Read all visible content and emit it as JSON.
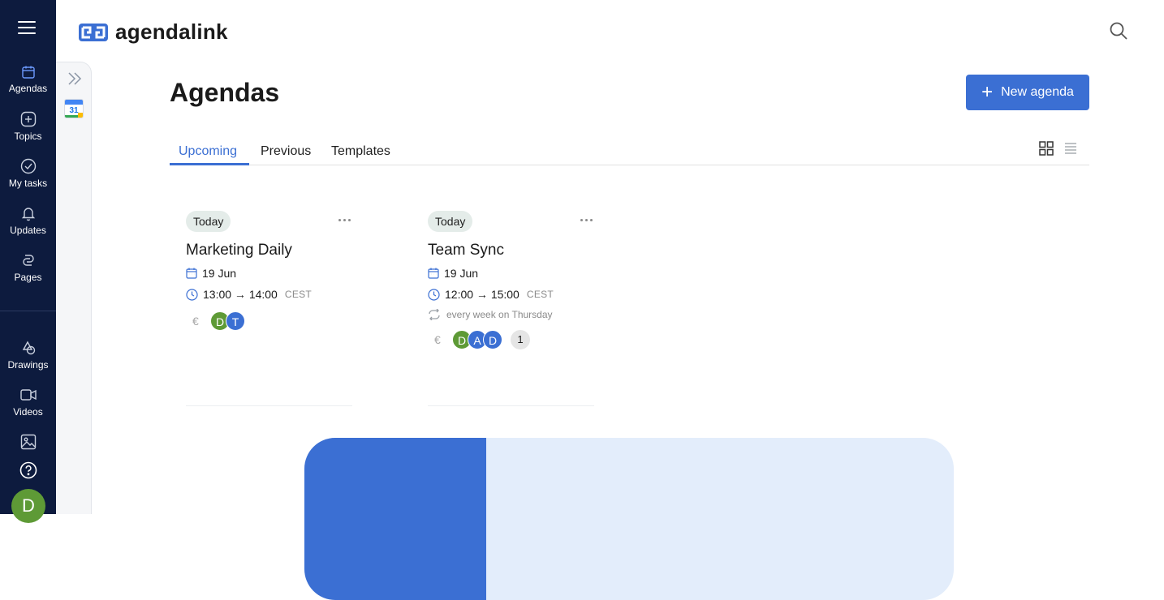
{
  "colors": {
    "rail_bg": "#0d1b3e",
    "accent": "#3b6fd3",
    "avatar_green": "#5e9a36",
    "today_badge": "#e4ece9"
  },
  "rail": {
    "menu_icon": "hamburger-icon",
    "items": [
      {
        "label": "Agendas",
        "icon": "calendar-icon",
        "active": true
      },
      {
        "label": "Topics",
        "icon": "plus-square-icon"
      },
      {
        "label": "My tasks",
        "icon": "check-circle-icon"
      },
      {
        "label": "Updates",
        "icon": "bell-icon"
      },
      {
        "label": "Pages",
        "icon": "pages-icon"
      },
      {
        "label": "Drawings",
        "icon": "shapes-icon"
      },
      {
        "label": "Videos",
        "icon": "video-icon"
      }
    ],
    "image_icon": "image-icon",
    "help_icon": "help-circle-icon",
    "user_initial": "D"
  },
  "subrail": {
    "expand_icon": "double-chevron-right-icon",
    "calendar_app_day": "31"
  },
  "header": {
    "logo_text": "agendalink",
    "search_icon": "search-icon"
  },
  "page": {
    "title": "Agendas",
    "new_button": {
      "label": "New agenda",
      "icon": "plus-icon"
    },
    "tabs": [
      {
        "label": "Upcoming",
        "active": true
      },
      {
        "label": "Previous"
      },
      {
        "label": "Templates"
      }
    ],
    "view_icons": [
      "grid-view-icon",
      "list-view-icon"
    ]
  },
  "cards": [
    {
      "badge": "Today",
      "title": "Marketing Daily",
      "date": "19 Jun",
      "time": "13:00 → 14:00",
      "tz": "CEST",
      "recurrence": "",
      "currency": "€",
      "attendees": [
        {
          "initial": "D",
          "color": "green"
        },
        {
          "initial": "T",
          "color": "blue"
        }
      ],
      "extra_count": ""
    },
    {
      "badge": "Today",
      "title": "Team Sync",
      "date": "19 Jun",
      "time": "12:00 → 15:00",
      "tz": "CEST",
      "recurrence": "every week on Thursday",
      "currency": "€",
      "attendees": [
        {
          "initial": "D",
          "color": "green"
        },
        {
          "initial": "A",
          "color": "blue"
        },
        {
          "initial": "D",
          "color": "blue"
        }
      ],
      "extra_count": "1"
    }
  ]
}
